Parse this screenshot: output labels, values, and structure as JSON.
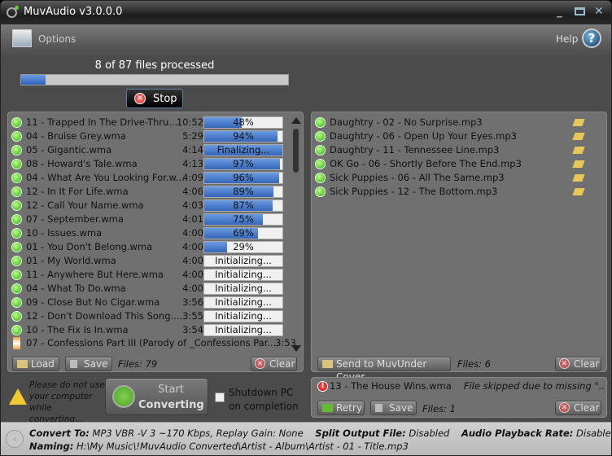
{
  "window": {
    "title": "MuvAudio v3.0.0.0"
  },
  "toolbar": {
    "options_label": "Options",
    "help_label": "Help"
  },
  "progress": {
    "label": "8 of 87 files processed",
    "processed": 8,
    "total": 87,
    "stop_label": "Stop"
  },
  "queue": {
    "rows": [
      {
        "name": "11 - Trapped In The Drive-Thru...",
        "time": "10:52",
        "pct": 48,
        "label": "48%"
      },
      {
        "name": "04 - Bruise Grey.wma",
        "time": "5:29",
        "pct": 94,
        "label": "94%"
      },
      {
        "name": "05 - Gigantic.wma",
        "time": "4:14",
        "pct": 100,
        "label": "Finalizing..."
      },
      {
        "name": "08 - Howard's Tale.wma",
        "time": "4:13",
        "pct": 97,
        "label": "97%"
      },
      {
        "name": "04 - What Are You Looking For.w...",
        "time": "4:09",
        "pct": 96,
        "label": "96%"
      },
      {
        "name": "12 - In It For Life.wma",
        "time": "4:06",
        "pct": 89,
        "label": "89%"
      },
      {
        "name": "12 - Call Your Name.wma",
        "time": "4:03",
        "pct": 87,
        "label": "87%"
      },
      {
        "name": "07 - September.wma",
        "time": "4:01",
        "pct": 75,
        "label": "75%"
      },
      {
        "name": "10 - Issues.wma",
        "time": "4:00",
        "pct": 69,
        "label": "69%"
      },
      {
        "name": "01 - You Don't Belong.wma",
        "time": "4:00",
        "pct": 29,
        "label": "29%"
      },
      {
        "name": "01 - My World.wma",
        "time": "4:00",
        "pct": 0,
        "label": "Initializing..."
      },
      {
        "name": "11 - Anywhere But Here.wma",
        "time": "4:00",
        "pct": 0,
        "label": "Initializing..."
      },
      {
        "name": "04 - What To Do.wma",
        "time": "4:00",
        "pct": 0,
        "label": "Initializing..."
      },
      {
        "name": "09 - Close But No Cigar.wma",
        "time": "3:56",
        "pct": 0,
        "label": "Initializing..."
      },
      {
        "name": "12 - Don't Download This Song....",
        "time": "3:55",
        "pct": 0,
        "label": "Initializing..."
      },
      {
        "name": "10 - The Fix Is In.wma",
        "time": "3:54",
        "pct": 0,
        "label": "Initializing..."
      }
    ],
    "pending": {
      "name": "07 - Confessions Part III (Parody of _Confessions Par...",
      "time": "3:53"
    },
    "load_label": "Load",
    "save_label": "Save",
    "files_label": "Files: 79",
    "clear_label": "Clear"
  },
  "completed": {
    "rows": [
      "Daughtry - 02 - No Surprise.mp3",
      "Daughtry - 06 - Open Up Your Eyes.mp3",
      "Daughtry - 11 - Tennessee Line.mp3",
      "OK Go - 06 - Shortly Before The End.mp3",
      "Sick Puppies - 06 - All The Same.mp3",
      "Sick Puppies - 12 - The Bottom.mp3"
    ],
    "send_label": "Send to MuvUnder Cover",
    "files_label": "Files: 6",
    "clear_label": "Clear"
  },
  "errors": {
    "name": "13 - The House Wins.wma",
    "message": "File skipped due to missing \"..",
    "retry_label": "Retry",
    "save_label": "Save",
    "files_label": "Files: 1",
    "clear_label": "Clear"
  },
  "convert": {
    "warning": "Please do not use your computer while converting...",
    "start_line1": "Start",
    "start_line2": "Converting",
    "shutdown_label": "Shutdown PC on completion"
  },
  "status": {
    "convert_to_label": "Convert To:",
    "convert_to": "MP3 VBR -V 3 ~170 Kbps, Replay Gain: None",
    "split_label": "Split Output File:",
    "split": "Disabled",
    "rate_label": "Audio Playback Rate:",
    "rate": "Disabled",
    "naming_label": "Naming:",
    "naming": "H:\\My Music\\!MuvAudio Converted\\Artist - Album\\Artist - 01 - Title.mp3"
  }
}
